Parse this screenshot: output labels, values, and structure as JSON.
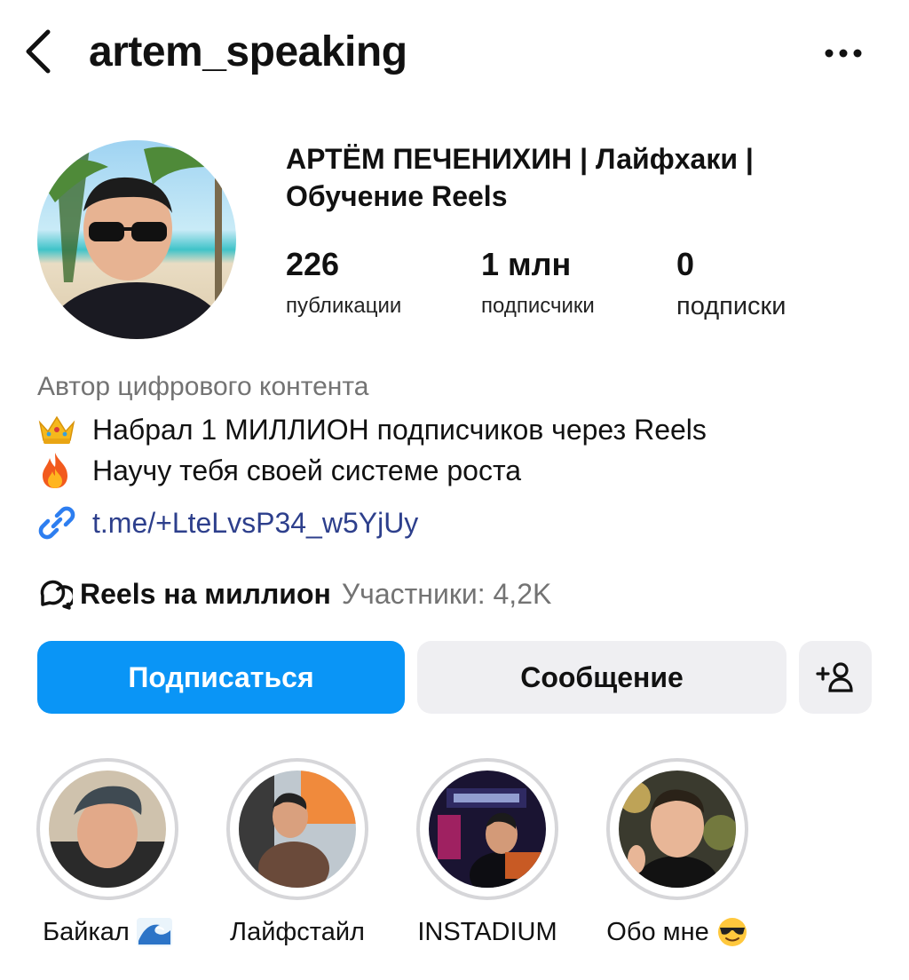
{
  "header": {
    "username": "artem_speaking",
    "back_icon": "chevron-left-icon",
    "more_icon": "ellipsis-icon"
  },
  "profile": {
    "display_name": "АРТЁМ ПЕЧЕНИХИН | Лайфхаки | Обучение Reels",
    "stats": [
      {
        "value": "226",
        "label": "публикации"
      },
      {
        "value": "1 млн",
        "label": "подписчики"
      },
      {
        "value": "0",
        "label": "подписки"
      }
    ]
  },
  "bio": {
    "category": "Автор цифрового контента",
    "lines": [
      {
        "emoji": "crown-icon",
        "text": "Набрал 1 МИЛЛИОН подписчиков через Reels"
      },
      {
        "emoji": "fire-icon",
        "text": "Научу тебя своей системе роста"
      }
    ],
    "link": "t.me/+LteLvsP34_w5YjUy"
  },
  "community": {
    "name": "Reels на миллион",
    "members": "Участники: 4,2K"
  },
  "actions": {
    "follow": "Подписаться",
    "message": "Сообщение"
  },
  "highlights": [
    {
      "label": "Байкал",
      "emoji": "wave-icon"
    },
    {
      "label": "Лайфстайл"
    },
    {
      "label": "INSTADIUM"
    },
    {
      "label": "Обо мне",
      "emoji": "sunglasses-face-icon"
    }
  ],
  "colors": {
    "accent": "#0a95f6",
    "secondary_button": "#efeff2",
    "muted_text": "#737373",
    "link": "#2d3f8c"
  }
}
